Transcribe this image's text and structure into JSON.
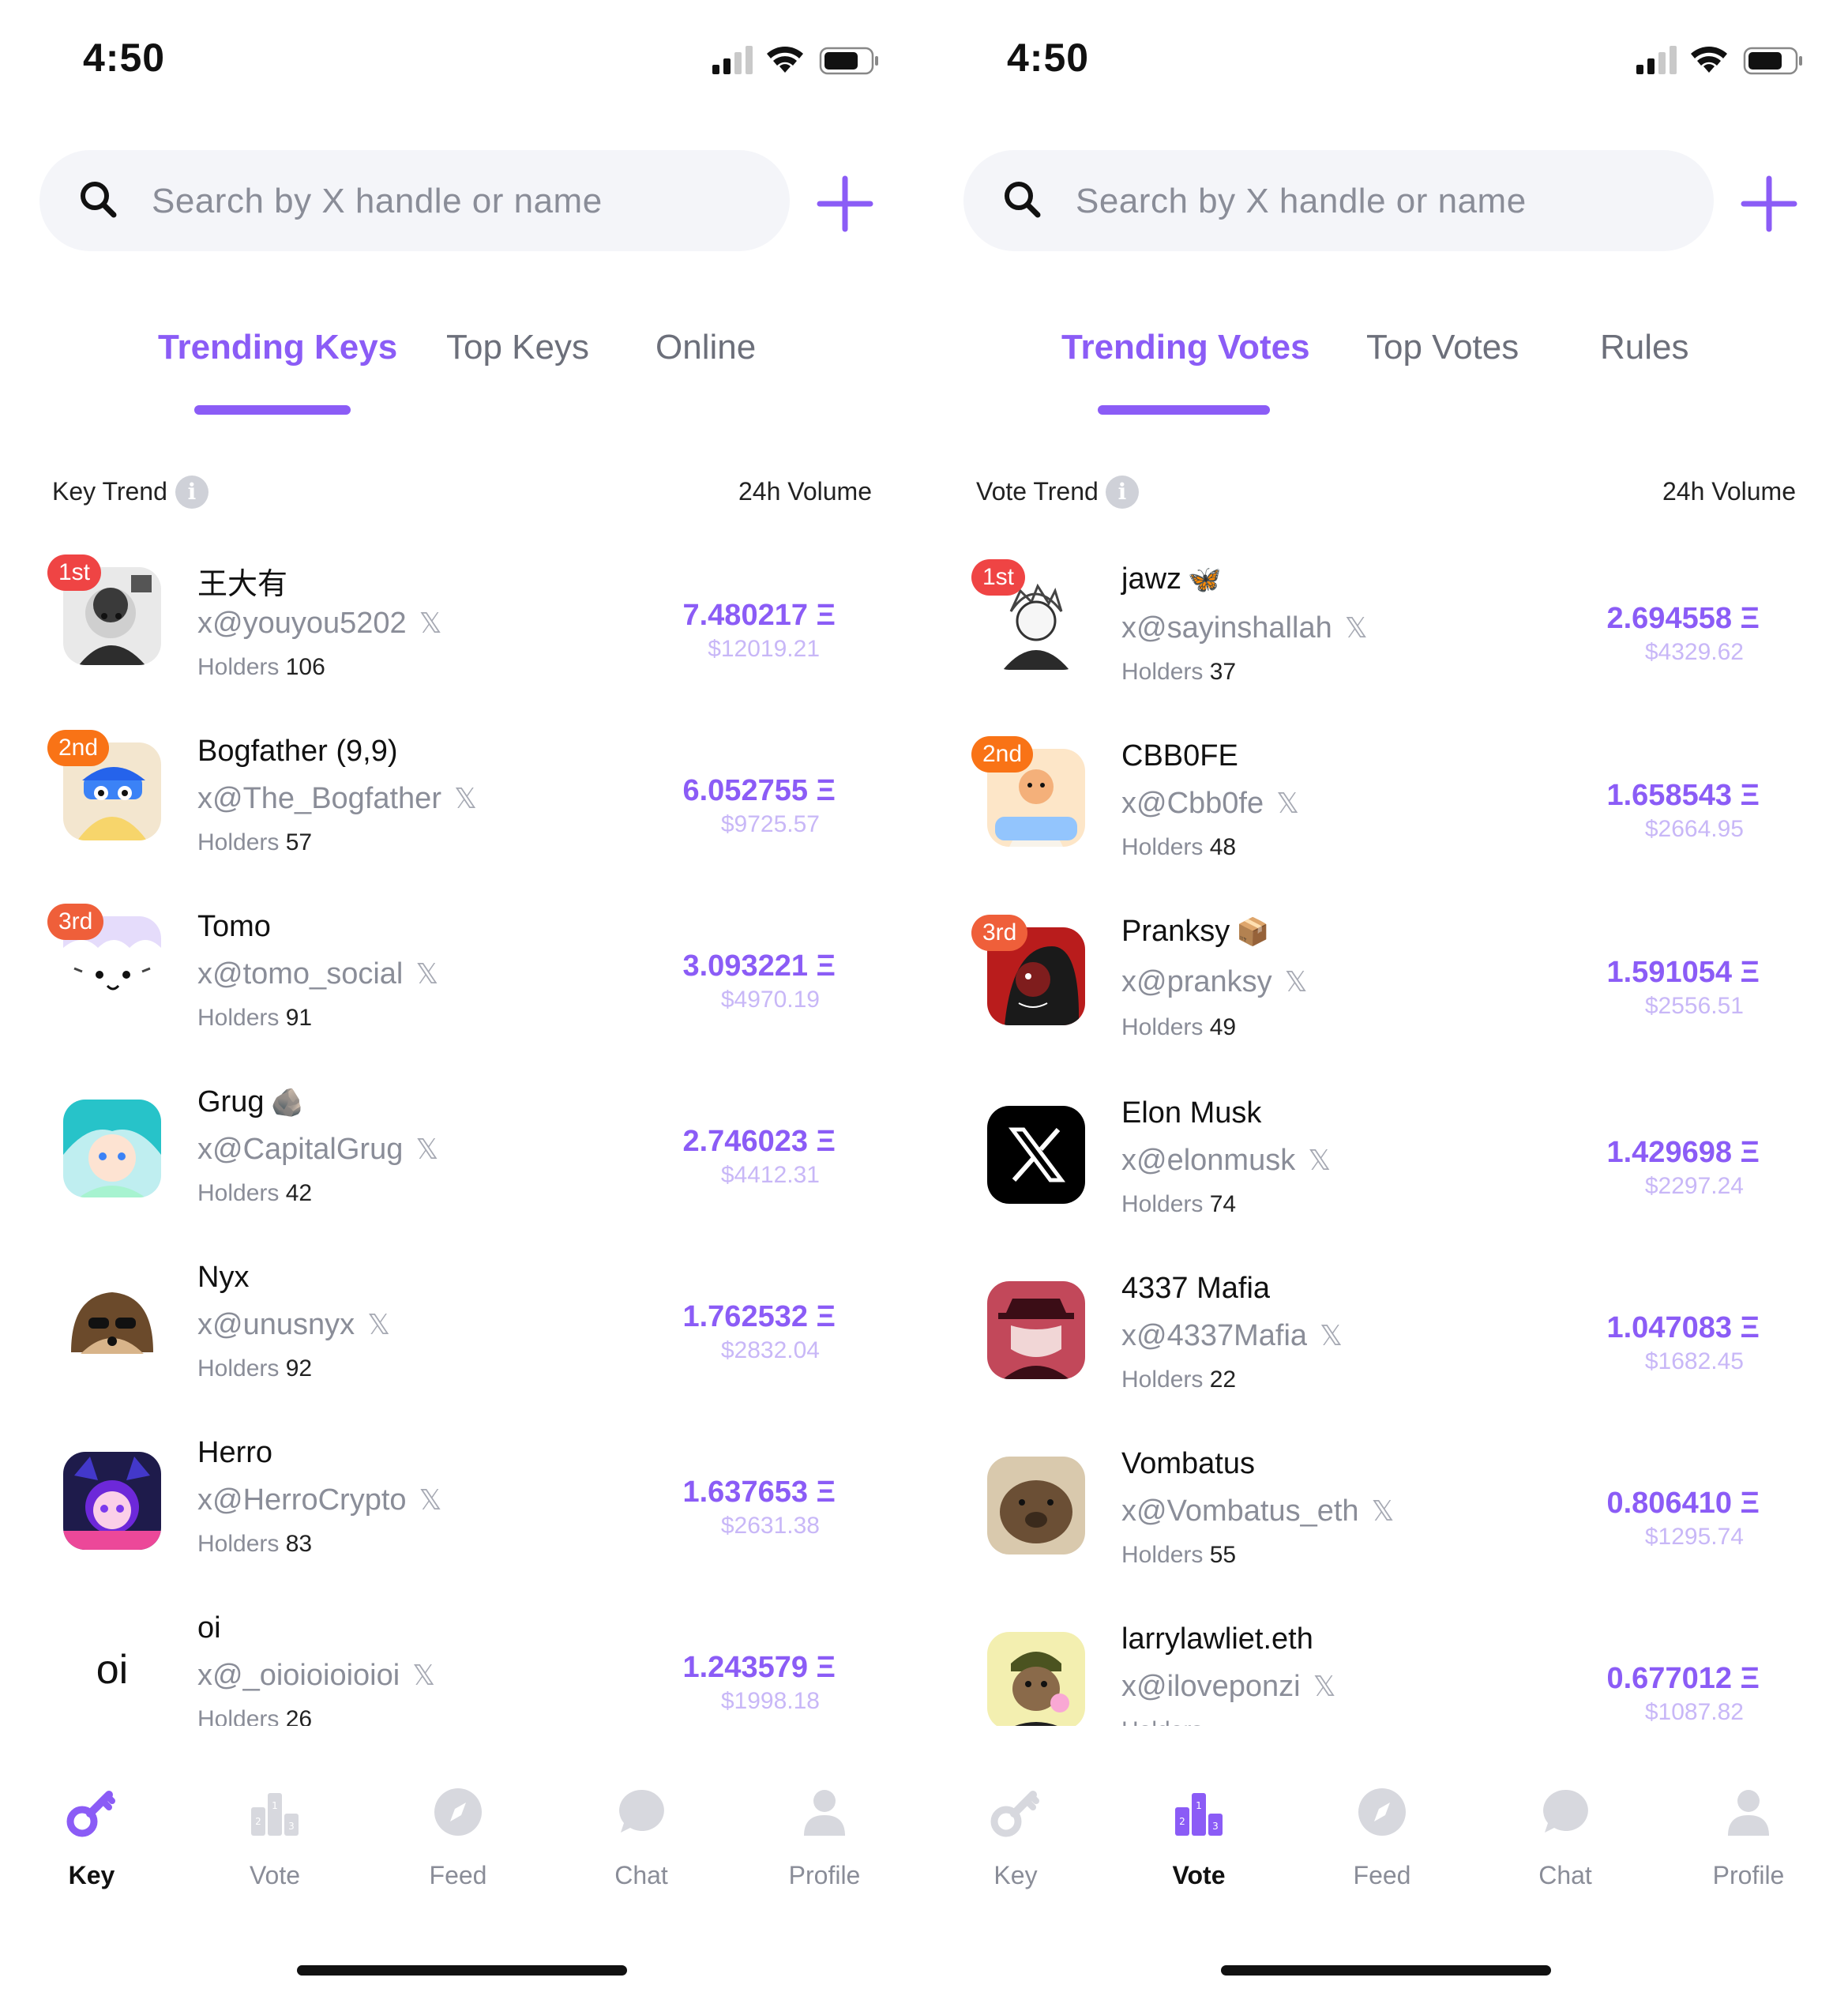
{
  "left": {
    "status_time": "4:50",
    "search_placeholder": "Search by X handle or name",
    "tabs": [
      {
        "label": "Trending Keys",
        "active": true
      },
      {
        "label": "Top Keys",
        "active": false
      },
      {
        "label": "Online",
        "active": false
      }
    ],
    "list_header": {
      "left": "Key Trend",
      "right": "24h Volume"
    },
    "rows": [
      {
        "rank": "1st",
        "name": "王大有",
        "emoji": "",
        "handle": "x@youyou5202",
        "holders_label": "Holders",
        "holders": "106",
        "volume": "7.480217 Ξ",
        "usd": "$12019.21",
        "avatar": "photo-child-avatar"
      },
      {
        "rank": "2nd",
        "name": "Bogfather (9,9)",
        "emoji": "",
        "handle": "x@The_Bogfather",
        "holders_label": "Holders",
        "holders": "57",
        "volume": "6.052755 Ξ",
        "usd": "$9725.57",
        "avatar": "cartoon-frog-avatar"
      },
      {
        "rank": "3rd",
        "name": "Tomo",
        "emoji": "",
        "handle": "x@tomo_social",
        "holders_label": "Holders",
        "holders": "91",
        "volume": "3.093221 Ξ",
        "usd": "$4970.19",
        "avatar": "cat-sketch-avatar"
      },
      {
        "rank": "",
        "name": "Grug",
        "emoji": "🪨",
        "handle": "x@CapitalGrug",
        "holders_label": "Holders",
        "holders": "42",
        "volume": "2.746023 Ξ",
        "usd": "$4412.31",
        "avatar": "anime-girl-avatar"
      },
      {
        "rank": "",
        "name": "Nyx",
        "emoji": "",
        "handle": "x@unusnyx",
        "holders_label": "Holders",
        "holders": "92",
        "volume": "1.762532 Ξ",
        "usd": "$2832.04",
        "avatar": "hedgehog-avatar"
      },
      {
        "rank": "",
        "name": "Herro",
        "emoji": "",
        "handle": "x@HerroCrypto",
        "holders_label": "Holders",
        "holders": "83",
        "volume": "1.637653 Ξ",
        "usd": "$2631.38",
        "avatar": "anime-purple-avatar"
      },
      {
        "rank": "",
        "name": "oi",
        "emoji": "",
        "handle": "x@_oioioioioioi",
        "holders_label": "Holders",
        "holders": "26",
        "volume": "1.243579 Ξ",
        "usd": "$1998.18",
        "avatar": "oi-text-avatar",
        "avatar_text": "oi"
      }
    ],
    "nav": [
      {
        "label": "Key",
        "icon": "key-icon",
        "active": true
      },
      {
        "label": "Vote",
        "icon": "podium-icon",
        "active": false
      },
      {
        "label": "Feed",
        "icon": "compass-icon",
        "active": false
      },
      {
        "label": "Chat",
        "icon": "chat-bubble-icon",
        "active": false
      },
      {
        "label": "Profile",
        "icon": "person-icon",
        "active": false
      }
    ]
  },
  "right": {
    "status_time": "4:50",
    "search_placeholder": "Search by X handle or name",
    "tabs": [
      {
        "label": "Trending Votes",
        "active": true
      },
      {
        "label": "Top Votes",
        "active": false
      },
      {
        "label": "Rules",
        "active": false
      }
    ],
    "list_header": {
      "left": "Vote Trend",
      "right": "24h Volume"
    },
    "rows": [
      {
        "rank": "1st",
        "name": "jawz",
        "emoji": "🦋",
        "handle": "x@sayinshallah",
        "holders_label": "Holders",
        "holders": "37",
        "volume": "2.694558 Ξ",
        "usd": "$4329.62",
        "avatar": "manga-sketch-avatar"
      },
      {
        "rank": "2nd",
        "name": "CBB0FE",
        "emoji": "",
        "handle": "x@Cbb0fe",
        "holders_label": "Holders",
        "holders": "48",
        "volume": "1.658543 Ξ",
        "usd": "$2664.95",
        "avatar": "cartoon-character-avatar"
      },
      {
        "rank": "3rd",
        "name": "Pranksy",
        "emoji": "📦",
        "handle": "x@pranksy",
        "holders_label": "Holders",
        "holders": "49",
        "volume": "1.591054 Ξ",
        "usd": "$2556.51",
        "avatar": "red-portrait-avatar"
      },
      {
        "rank": "",
        "name": "Elon Musk",
        "emoji": "",
        "handle": "x@elonmusk",
        "holders_label": "Holders",
        "holders": "74",
        "volume": "1.429698 Ξ",
        "usd": "$2297.24",
        "avatar": "x-logo-avatar"
      },
      {
        "rank": "",
        "name": "4337 Mafia",
        "emoji": "",
        "handle": "x@4337Mafia",
        "holders_label": "Holders",
        "holders": "22",
        "volume": "1.047083 Ξ",
        "usd": "$1682.45",
        "avatar": "mafia-avatar"
      },
      {
        "rank": "",
        "name": "Vombatus",
        "emoji": "",
        "handle": "x@Vombatus_eth",
        "holders_label": "Holders",
        "holders": "55",
        "volume": "0.806410 Ξ",
        "usd": "$1295.74",
        "avatar": "wombat-avatar"
      },
      {
        "rank": "",
        "name": "larrylawliet.eth",
        "emoji": "",
        "handle": "x@iloveponzi",
        "holders_label": "Holders",
        "holders": "",
        "volume": "0.677012 Ξ",
        "usd": "$1087.82",
        "avatar": "ape-avatar"
      }
    ],
    "nav": [
      {
        "label": "Key",
        "icon": "key-icon",
        "active": false
      },
      {
        "label": "Vote",
        "icon": "podium-icon",
        "active": true
      },
      {
        "label": "Feed",
        "icon": "compass-icon",
        "active": false
      },
      {
        "label": "Chat",
        "icon": "chat-bubble-icon",
        "active": false
      },
      {
        "label": "Profile",
        "icon": "person-icon",
        "active": false
      }
    ]
  },
  "colors": {
    "accent": "#8b5cf6",
    "rank_first": "#ef4444",
    "rank_second": "#f97316",
    "muted": "#8a8d98",
    "usd": "#c8b7f7"
  }
}
